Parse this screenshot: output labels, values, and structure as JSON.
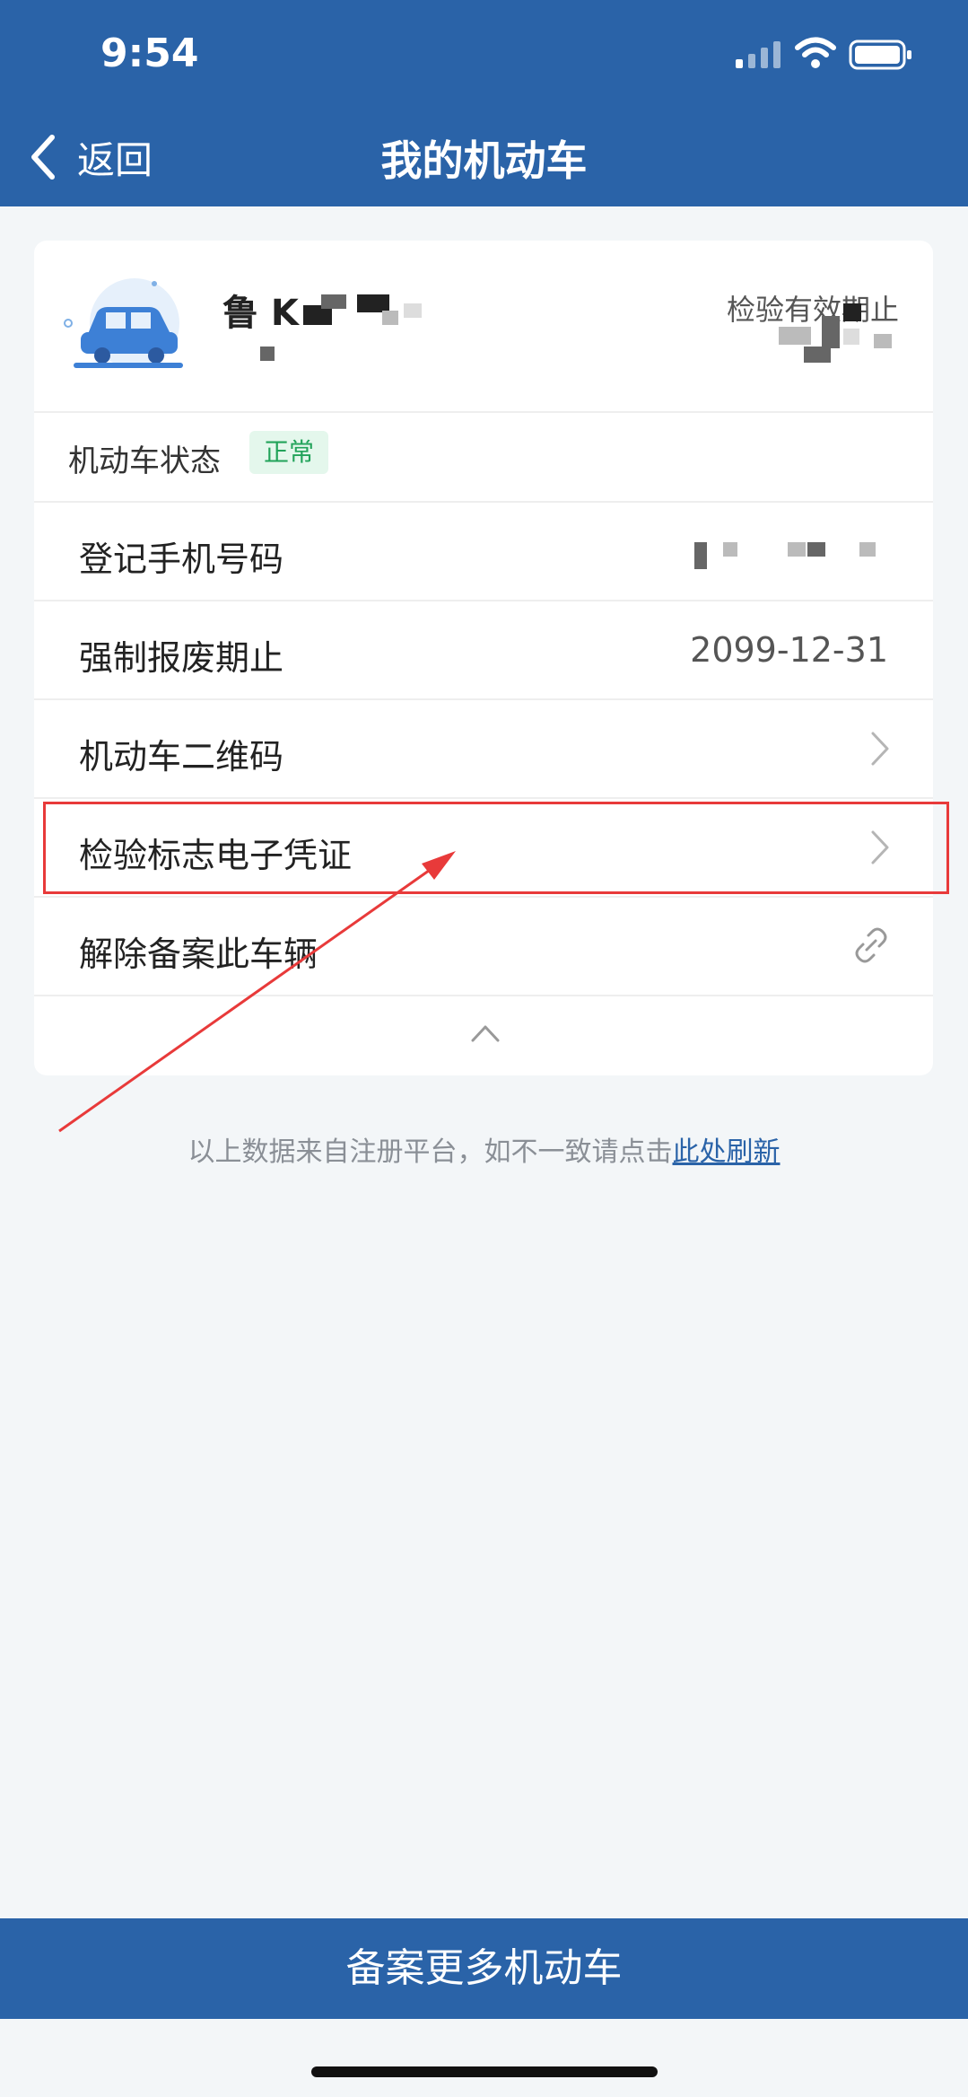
{
  "status_bar": {
    "time": "9:54"
  },
  "header": {
    "back_label": "返回",
    "title": "我的机动车"
  },
  "vehicle": {
    "plate": "鲁 K",
    "inspection_label": "检验有效期止",
    "status_label": "机动车状态",
    "status_badge": "正常"
  },
  "rows": [
    {
      "label": "登记手机号码",
      "value": ""
    },
    {
      "label": "强制报废期止",
      "value": "2099-12-31"
    },
    {
      "label": "机动车二维码"
    },
    {
      "label": "检验标志电子凭证"
    },
    {
      "label": "解除备案此车辆"
    }
  ],
  "note": {
    "text": "以上数据来自注册平台，如不一致请点击",
    "link": "此处刷新"
  },
  "bottom_button": "备案更多机动车",
  "colors": {
    "brand": "#2a63a8",
    "badge_green": "#22a35a",
    "highlight_red": "#e83a3a"
  }
}
